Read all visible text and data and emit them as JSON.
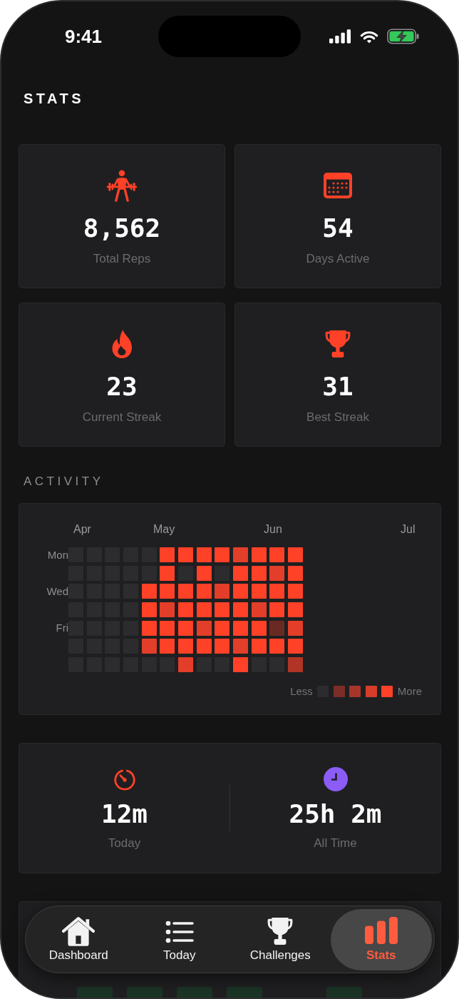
{
  "status_bar": {
    "time": "9:41"
  },
  "title": "STATS",
  "stat_cards": [
    {
      "kind": "reps",
      "value": "8,562",
      "label": "Total Reps"
    },
    {
      "kind": "days",
      "value": "54",
      "label": "Days Active"
    },
    {
      "kind": "streak",
      "value": "23",
      "label": "Current Streak"
    },
    {
      "kind": "record",
      "value": "31",
      "label": "Best Streak"
    }
  ],
  "activity": {
    "heading": "ACTIVITY",
    "months": [
      "Apr",
      "May",
      "Jun",
      "Jul"
    ],
    "rows": [
      {
        "label": "Mon",
        "cells": [
          {
            "color": "#2c2c2e"
          },
          {
            "color": "#2c2c2e"
          },
          {
            "color": "#2c2c2e"
          },
          {
            "color": "#2c2c2e"
          },
          {
            "color": "#2c2c2e"
          },
          {
            "color": "#ff4127"
          },
          {
            "color": "#ff4127"
          },
          {
            "color": "#ff4127"
          },
          {
            "color": "#ff4127"
          },
          {
            "color": "#e33e29"
          },
          {
            "color": "#ff4127"
          },
          {
            "color": "#ff4127"
          },
          {
            "color": "#ff4127"
          }
        ]
      },
      {
        "cells": [
          {
            "color": "#2c2c2e"
          },
          {
            "color": "#2c2c2e"
          },
          {
            "color": "#2c2c2e"
          },
          {
            "color": "#2c2c2e"
          },
          {
            "color": "#2c2c2e"
          },
          {
            "color": "#ff4127"
          },
          {
            "color": "#2c2c2e"
          },
          {
            "color": "#ff4127"
          },
          {
            "color": "#2c2c2e"
          },
          {
            "color": "#ff4127"
          },
          {
            "color": "#ff4127"
          },
          {
            "color": "#e33e29"
          },
          {
            "color": "#ff4127"
          }
        ]
      },
      {
        "label": "Wed",
        "cells": [
          {
            "color": "#2c2c2e"
          },
          {
            "color": "#2c2c2e"
          },
          {
            "color": "#2c2c2e"
          },
          {
            "color": "#2c2c2e"
          },
          {
            "color": "#ff4127"
          },
          {
            "color": "#ff4127"
          },
          {
            "color": "#ff4127"
          },
          {
            "color": "#ff4127"
          },
          {
            "color": "#e33e29"
          },
          {
            "color": "#ff4127"
          },
          {
            "color": "#ff4127"
          },
          {
            "color": "#ff4127"
          },
          {
            "color": "#ff4127"
          }
        ]
      },
      {
        "cells": [
          {
            "color": "#2c2c2e"
          },
          {
            "color": "#2c2c2e"
          },
          {
            "color": "#2c2c2e"
          },
          {
            "color": "#2c2c2e"
          },
          {
            "color": "#ff4127"
          },
          {
            "color": "#e33e29"
          },
          {
            "color": "#ff4127"
          },
          {
            "color": "#ff4127"
          },
          {
            "color": "#ff4127"
          },
          {
            "color": "#ff4127"
          },
          {
            "color": "#e33e29"
          },
          {
            "color": "#ff4127"
          },
          {
            "color": "#ff4127"
          }
        ]
      },
      {
        "label": "Fri",
        "cells": [
          {
            "color": "#2c2c2e"
          },
          {
            "color": "#2c2c2e"
          },
          {
            "color": "#2c2c2e"
          },
          {
            "color": "#2c2c2e"
          },
          {
            "color": "#ff4127"
          },
          {
            "color": "#ff4127"
          },
          {
            "color": "#ff4127"
          },
          {
            "color": "#e33e29"
          },
          {
            "color": "#ff4127"
          },
          {
            "color": "#ff4127"
          },
          {
            "color": "#ff4127"
          },
          {
            "color": "#6a2a24"
          },
          {
            "color": "#e33e29"
          }
        ]
      },
      {
        "cells": [
          {
            "color": "#2c2c2e"
          },
          {
            "color": "#2c2c2e"
          },
          {
            "color": "#2c2c2e"
          },
          {
            "color": "#2c2c2e"
          },
          {
            "color": "#e33e29"
          },
          {
            "color": "#ff4127"
          },
          {
            "color": "#ff4127"
          },
          {
            "color": "#ff4127"
          },
          {
            "color": "#ff4127"
          },
          {
            "color": "#e33e29"
          },
          {
            "color": "#ff4127"
          },
          {
            "color": "#ff4127"
          },
          {
            "color": "#ff4127"
          }
        ]
      },
      {
        "cells": [
          {
            "color": "#2c2c2e"
          },
          {
            "color": "#2c2c2e"
          },
          {
            "color": "#2c2c2e"
          },
          {
            "color": "#2c2c2e"
          },
          {
            "color": "#2c2c2e"
          },
          {
            "color": "#2c2c2e"
          },
          {
            "color": "#e33e29"
          },
          {
            "color": "#2c2c2e"
          },
          {
            "color": "#2c2c2e"
          },
          {
            "color": "#ff4127"
          },
          {
            "color": "#2c2c2e"
          },
          {
            "color": "#2c2c2e"
          },
          {
            "color": "#b13526"
          }
        ]
      }
    ],
    "legend": {
      "less": "Less",
      "swatches": [
        {
          "color": "#2c2c2e"
        },
        {
          "color": "#7b2d27"
        },
        {
          "color": "#a8352a"
        },
        {
          "color": "#d63d2b"
        },
        {
          "color": "#ff4127"
        }
      ],
      "more": "More"
    }
  },
  "time_stats": [
    {
      "kind": "today",
      "value": "12m",
      "label": "Today"
    },
    {
      "kind": "total",
      "value": "25h 2m",
      "label": "All Time"
    }
  ],
  "nav": {
    "items": [
      {
        "kind": "dashboard",
        "label": "Dashboard",
        "selected": false
      },
      {
        "kind": "today",
        "label": "Today",
        "selected": false
      },
      {
        "kind": "challenges",
        "label": "Challenges",
        "selected": false
      },
      {
        "kind": "stats",
        "label": "Stats",
        "selected": true
      }
    ]
  }
}
